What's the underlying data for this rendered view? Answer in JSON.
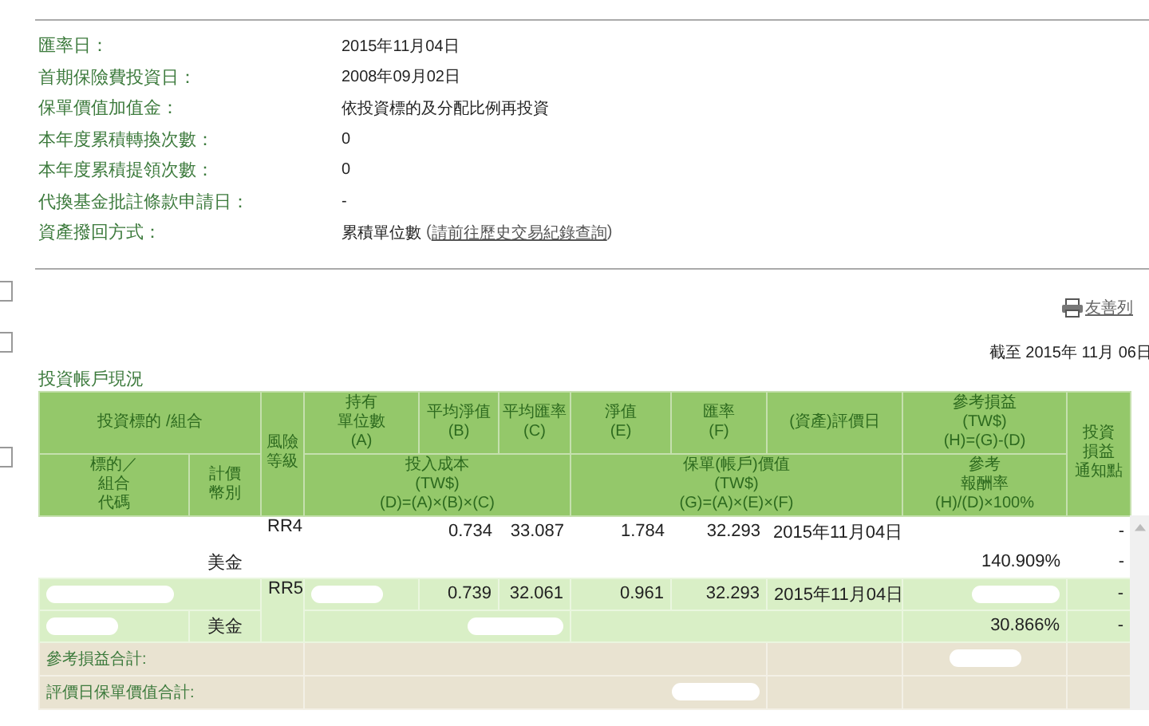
{
  "info": [
    {
      "label": "匯率日：",
      "value": "2015年11月04日"
    },
    {
      "label": "首期保險費投資日：",
      "value": "2008年09月02日"
    },
    {
      "label": "保單價值加值金：",
      "value": "依投資標的及分配比例再投資"
    },
    {
      "label": "本年度累積轉換次數：",
      "value": "0"
    },
    {
      "label": "本年度累積提領次數：",
      "value": "0"
    },
    {
      "label": "代換基金批註條款申請日：",
      "value": "-"
    },
    {
      "label": "資產撥回方式：",
      "value": "累積單位數",
      "link_open": "(",
      "link": "請前往歷史交易紀錄查詢",
      "link_close": ")"
    }
  ],
  "checkboxes": [
    {
      "checked": false
    },
    {
      "checked": false
    },
    {
      "checked": false
    }
  ],
  "print_link": "友善列",
  "as_of": "截至 2015年 11月 06日",
  "section_title": "投資帳戶現況",
  "header": {
    "fund_group": "投資標的 /組合",
    "risk": "風險等級",
    "units": [
      "持有",
      "單位數",
      "(A)"
    ],
    "avg_nav": [
      "平均淨值",
      "(B)"
    ],
    "avg_fx": [
      "平均匯率",
      "(C)"
    ],
    "nav": [
      "淨值",
      "(E)"
    ],
    "fx": [
      "匯率",
      "(F)"
    ],
    "date": "(資產)評價日",
    "profit": [
      "參考損益",
      "(TW$)",
      "(H)=(G)-(D)"
    ],
    "notify": [
      "投資",
      "損益",
      "通知點"
    ],
    "code": [
      "標的／",
      "組合",
      "代碼"
    ],
    "currency": [
      "計價",
      "幣別"
    ],
    "cost": [
      "投入成本",
      "(TW$)",
      "(D)=(A)×(B)×(C)"
    ],
    "value": [
      "保單(帳戶)價值",
      "(TW$)",
      "(G)=(A)×(E)×(F)"
    ],
    "return": [
      "參考",
      "報酬率",
      "(H)/(D)×100%"
    ]
  },
  "rows": [
    {
      "shaded": false,
      "risk": "RR4",
      "avg_nav": "0.734",
      "avg_fx": "33.087",
      "nav": "1.784",
      "fx": "32.293",
      "date": "2015年11月04日",
      "currency": "美金",
      "return": "140.909%",
      "notify": "-",
      "notify_2": "-"
    },
    {
      "shaded": true,
      "risk": "RR5",
      "avg_nav": "0.739",
      "avg_fx": "32.061",
      "nav": "0.961",
      "fx": "32.293",
      "date": "2015年11月04日",
      "currency": "美金",
      "return": "30.866%",
      "notify": "-",
      "notify_2": "-",
      "redacted": {
        "name": true,
        "units": true,
        "profit": true,
        "code": true,
        "cost": true
      }
    }
  ],
  "totals": [
    {
      "label": "參考損益合計:",
      "redacted": {
        "profit": true,
        "value": false
      }
    },
    {
      "label": "評價日保單價值合計:",
      "redacted": {
        "profit": false,
        "value": true
      }
    }
  ]
}
